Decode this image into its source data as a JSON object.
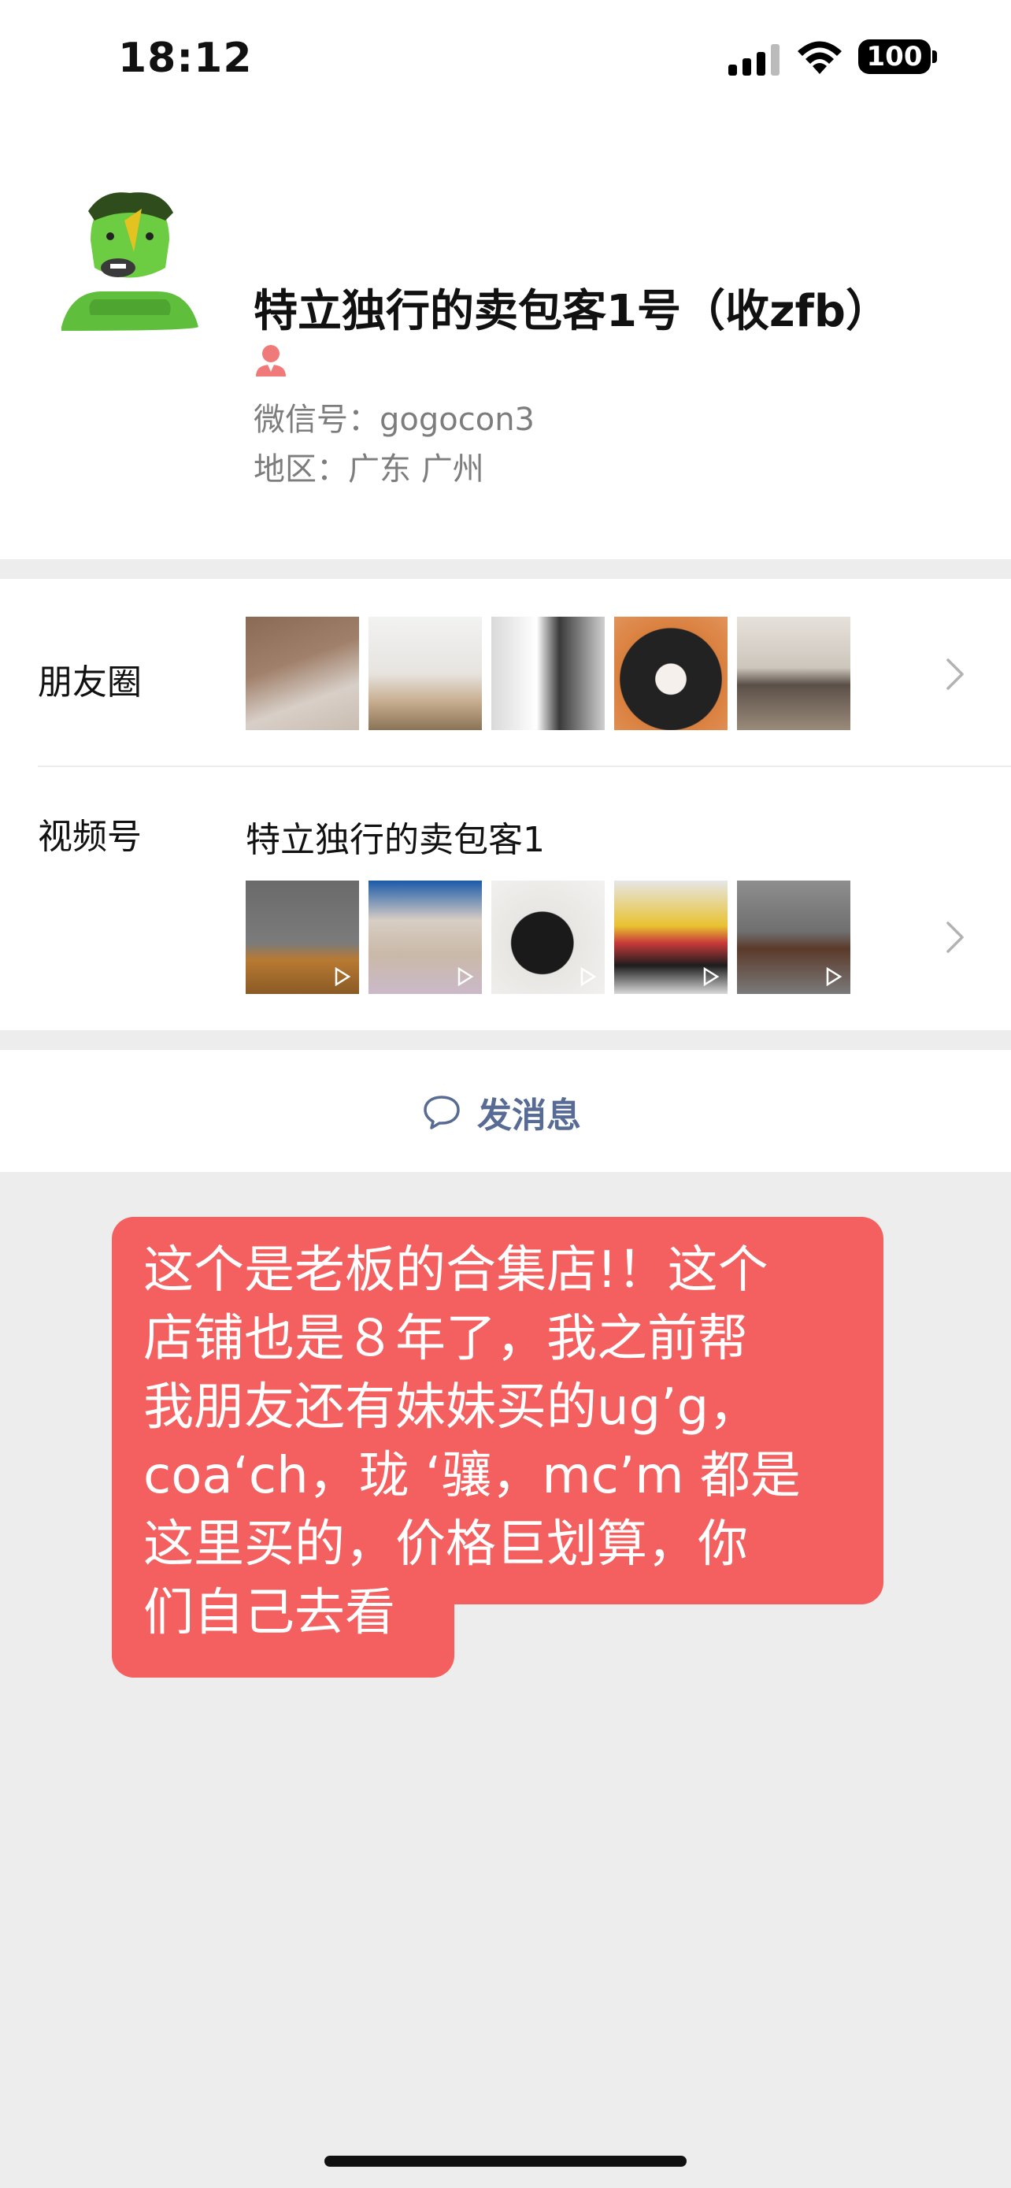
{
  "status_bar": {
    "time": "18:12",
    "battery": "100"
  },
  "profile": {
    "nickname": "特立独行的卖包客1号（收zfb）",
    "wechat_id": "微信号：gogocon3",
    "region": "地区：广东 广州"
  },
  "moments": {
    "label": "朋友圈"
  },
  "channels": {
    "label": "视频号",
    "name": "特立独行的卖包客1"
  },
  "send_message": {
    "label": "发消息"
  },
  "overlay": {
    "lines": [
      "这个是老板的合集店!！这个",
      "店铺也是８年了，我之前帮",
      "我朋友还有妹妹买的ug’g，",
      "coa‘ch，珑 ‘骧，mc’m 都是",
      "这里买的，价格巨划算，你",
      "们自己去看"
    ]
  },
  "colors": {
    "accent_link": "#576b95",
    "overlay_bg": "#f45f5f",
    "gender_icon": "#f07a7a"
  }
}
